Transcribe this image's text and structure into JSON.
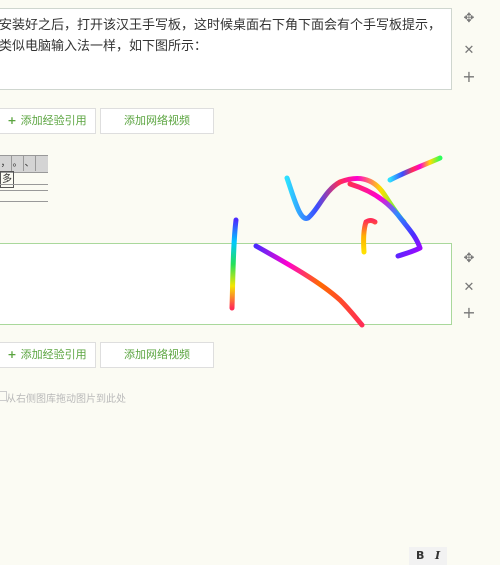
{
  "step1": {
    "text": "安装好之后，打开该汉王手写板，这时候桌面右下角下面会有个手写板提示，类似电脑输入法一样，如下图所示："
  },
  "buttons": {
    "add_reference": "添加经验引用",
    "add_video": "添加网络视频"
  },
  "toolbar": {
    "items": [
      "，",
      "。",
      "、",
      "多"
    ]
  },
  "format": {
    "bold": "B",
    "italic": "I"
  },
  "hint": "从右侧图库拖动图片到此处",
  "icons": {
    "move": "move-icon",
    "close": "close-icon",
    "add": "add-icon"
  }
}
